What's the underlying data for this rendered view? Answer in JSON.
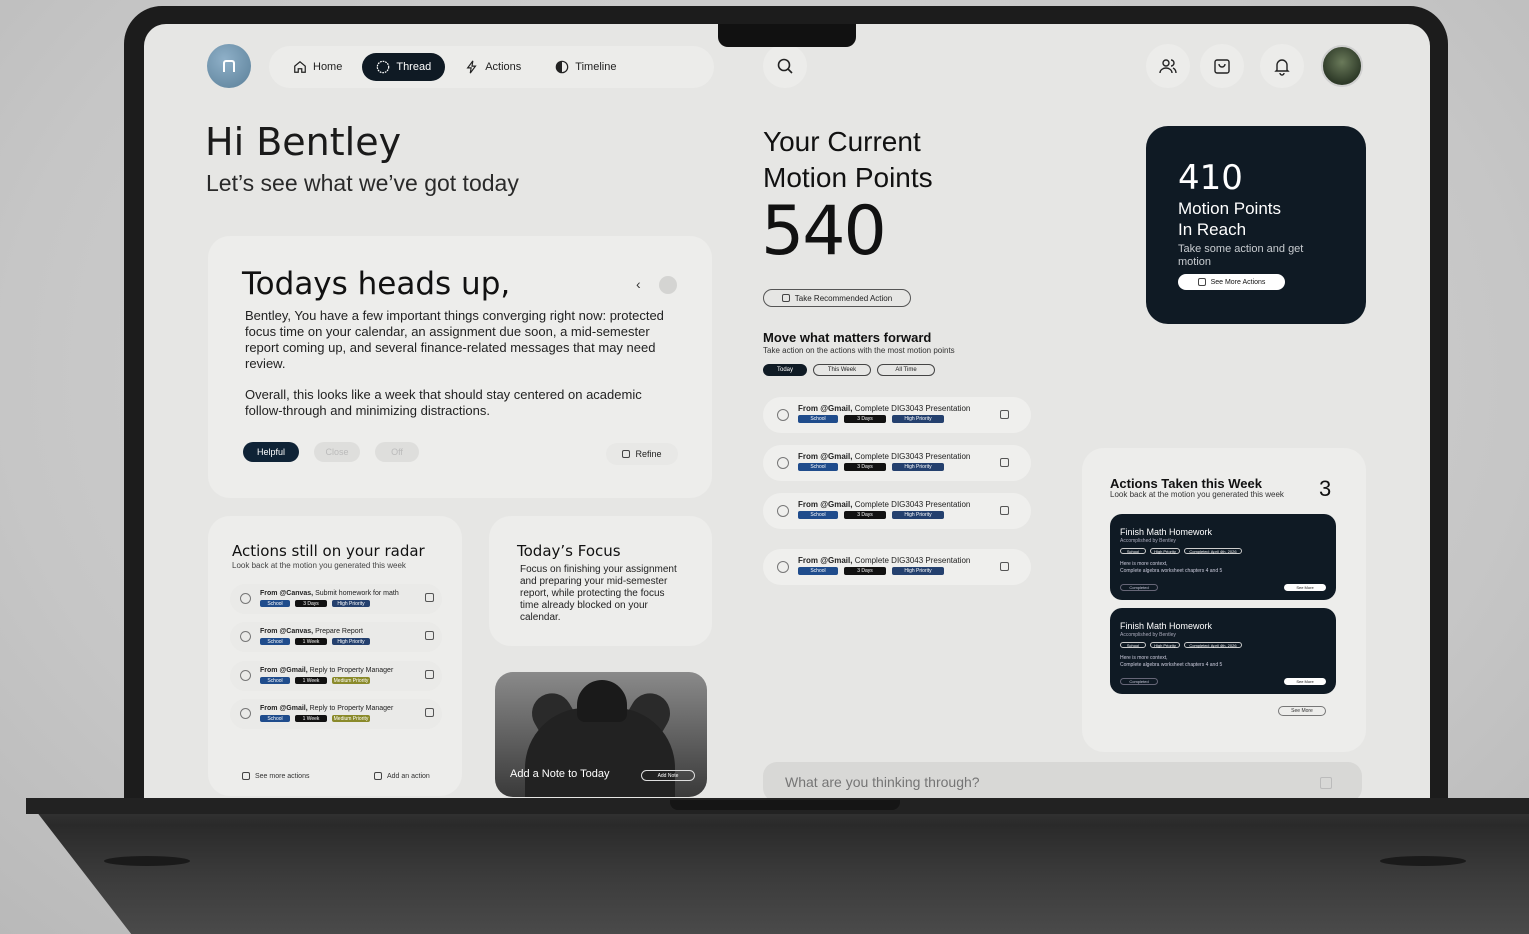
{
  "nav": {
    "items": [
      {
        "label": "Home",
        "icon": "home-icon"
      },
      {
        "label": "Thread",
        "icon": "circle-icon"
      },
      {
        "label": "Actions",
        "icon": "bolt-icon"
      },
      {
        "label": "Timeline",
        "icon": "half-circle-icon"
      }
    ],
    "active": "Thread"
  },
  "greeting": {
    "title": "Hi Bentley",
    "subtitle": "Let’s see what we’ve got today"
  },
  "heads_up": {
    "title": "Todays heads up,",
    "paragraph1": "Bentley, You have a few important things converging right now: protected focus time on your calendar, an assignment due soon, a mid-semester report coming up, and several finance-related messages that may need review.",
    "paragraph2": "Overall, this looks like a week that should stay centered on academic follow-through and minimizing distractions.",
    "buttons": {
      "helpful": "Helpful",
      "close": "Close",
      "off": "Off",
      "refine": "Refine"
    }
  },
  "radar": {
    "title": "Actions still on your radar",
    "subtitle": "Look back at the motion you generated this week",
    "items": [
      {
        "source": "From @Canvas,",
        "task": "Submit homework for math",
        "tags": [
          "School",
          "3 Days",
          "High Priority"
        ]
      },
      {
        "source": "From @Canvas,",
        "task": "Prepare Report",
        "tags": [
          "School",
          "1 Week",
          "High Priority"
        ]
      },
      {
        "source": "From @Gmail,",
        "task": "Reply to Property Manager",
        "tags": [
          "School",
          "1 Week",
          "Medium Priority"
        ]
      },
      {
        "source": "From @Gmail,",
        "task": "Reply to Property Manager",
        "tags": [
          "School",
          "1 Week",
          "Medium Priority"
        ]
      }
    ],
    "see_more": "See more actions",
    "add": "Add an action"
  },
  "focus": {
    "title": "Today’s Focus",
    "body": "Focus on finishing your assignment and preparing your mid-semester report, while protecting the focus time already blocked on your calendar."
  },
  "note": {
    "label": "Add a Note to Today",
    "button": "Add Note"
  },
  "points": {
    "title_line1": "Your Current",
    "title_line2": "Motion Points",
    "value": "540",
    "take_action": "Take Recommended Action"
  },
  "forward": {
    "title": "Move what matters forward",
    "subtitle": "Take action on the actions with the most motion points",
    "filters": [
      "Today",
      "This Week",
      "All Time"
    ],
    "items": [
      {
        "source": "From @Gmail,",
        "task": "Complete DIG3043 Presentation",
        "tags": [
          "School",
          "3 Days",
          "High Priority"
        ]
      },
      {
        "source": "From @Gmail,",
        "task": "Complete DIG3043 Presentation",
        "tags": [
          "School",
          "3 Days",
          "High Priority"
        ]
      },
      {
        "source": "From @Gmail,",
        "task": "Complete DIG3043 Presentation",
        "tags": [
          "School",
          "3 Days",
          "High Priority"
        ]
      },
      {
        "source": "From @Gmail,",
        "task": "Complete DIG3043 Presentation",
        "tags": [
          "School",
          "3 Days",
          "High Priority"
        ]
      }
    ]
  },
  "reach": {
    "value": "410",
    "label_line1": "Motion Points",
    "label_line2": "In Reach",
    "desc": "Take some action and get motion",
    "button": "See More Actions"
  },
  "week": {
    "title": "Actions Taken this Week",
    "subtitle": "Look back at the motion you generated this week",
    "count": "3",
    "cards": [
      {
        "title": "Finish Math Homework",
        "by": "Accomplished by Bentley",
        "chips": [
          "School",
          "High Priority",
          "Completed: April 4th, 2026"
        ],
        "context1": "Here is more context,",
        "context2": "Complete algebra worksheet chapters 4 and 5",
        "status": "Completed",
        "button": "See More"
      },
      {
        "title": "Finish Math Homework",
        "by": "Accomplished by Bentley",
        "chips": [
          "School",
          "High Priority",
          "Completed: April 4th, 2026"
        ],
        "context1": "Here is more context,",
        "context2": "Complete algebra worksheet chapters 4 and 5",
        "status": "Completed",
        "button": "See More"
      }
    ],
    "see_more": "See More"
  },
  "prompt": {
    "placeholder": "What are you thinking through?"
  }
}
